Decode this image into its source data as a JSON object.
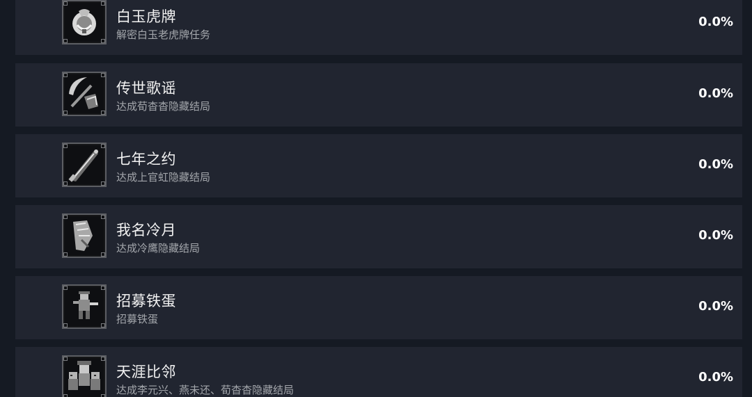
{
  "achievements": [
    {
      "title": "白玉虎牌",
      "description": "解密白玉老虎牌任务",
      "percent": "0.0%",
      "icon": "jade-tiger-token-icon"
    },
    {
      "title": "传世歌谣",
      "description": "达成荀杳杳隐藏结局",
      "percent": "0.0%",
      "icon": "scythe-icon"
    },
    {
      "title": "七年之约",
      "description": "达成上官虹隐藏结局",
      "percent": "0.0%",
      "icon": "blade-icon"
    },
    {
      "title": "我名冷月",
      "description": "达成冷鹰隐藏结局",
      "percent": "0.0%",
      "icon": "gauntlet-icon"
    },
    {
      "title": "招募铁蛋",
      "description": "招募铁蛋",
      "percent": "0.0%",
      "icon": "pixel-character-icon"
    },
    {
      "title": "天涯比邻",
      "description": "达成李元兴、燕未还、荀杳杳隐藏结局",
      "percent": "0.0%",
      "icon": "character-group-icon"
    }
  ]
}
